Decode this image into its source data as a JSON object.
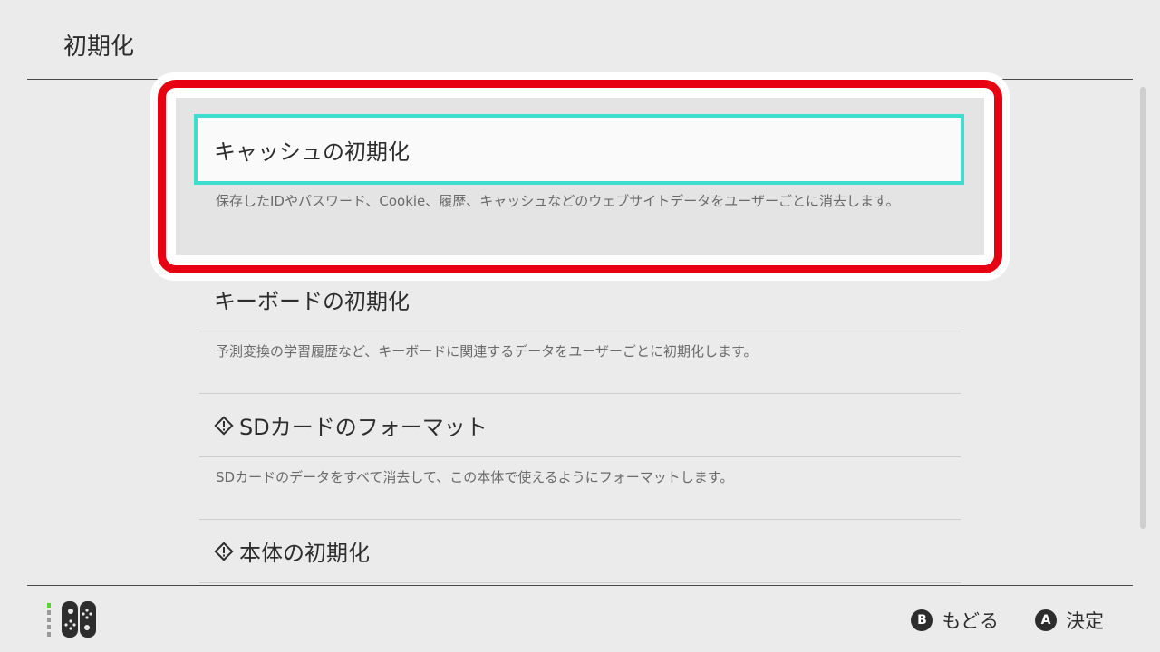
{
  "header": {
    "title": "初期化"
  },
  "menu": {
    "items": [
      {
        "label": "キャッシュの初期化",
        "description": "保存したIDやパスワード、Cookie、履歴、キャッシュなどのウェブサイトデータをユーザーごとに消去します。",
        "warning": false,
        "selected": true
      },
      {
        "label": "キーボードの初期化",
        "description": "予測変換の学習履歴など、キーボードに関連するデータをユーザーごとに初期化します。",
        "warning": false,
        "selected": false
      },
      {
        "label": "SDカードのフォーマット",
        "description": "SDカードのデータをすべて消去して、この本体で使えるようにフォーマットします。",
        "warning": true,
        "selected": false
      },
      {
        "label": "本体の初期化",
        "description": "",
        "warning": true,
        "selected": false
      }
    ]
  },
  "footer": {
    "controller_icon": "joy-con-icon",
    "actions": [
      {
        "button": "B",
        "label": "もどる"
      },
      {
        "button": "A",
        "label": "決定"
      }
    ]
  },
  "colors": {
    "background": "#ebebeb",
    "selection_border": "#3fdcd0",
    "highlight_red": "#e60012",
    "text": "#2d2d2d",
    "description_text": "#6a6a6a"
  }
}
